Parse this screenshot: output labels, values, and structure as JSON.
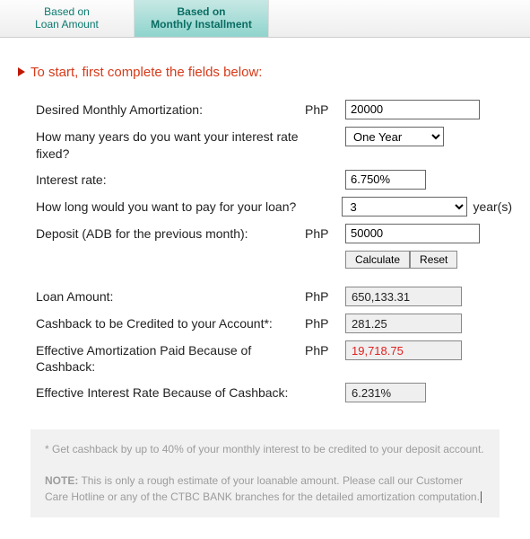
{
  "tabs": {
    "loan_amount": "Based on\nLoan Amount",
    "monthly_installment": "Based on\nMonthly Installment"
  },
  "heading": "To start, first complete the fields below:",
  "form": {
    "amortization_label": "Desired Monthly Amortization:",
    "amortization_currency": "PhP",
    "amortization_value": "20000",
    "years_fixed_label": "How many years do you want your interest rate fixed?",
    "years_fixed_value": "One Year",
    "interest_label": "Interest rate:",
    "interest_value": "6.750%",
    "pay_years_label": "How long would you want to pay for your loan?",
    "pay_years_value": "3",
    "pay_years_suffix": "year(s)",
    "deposit_label": "Deposit (ADB for the previous month):",
    "deposit_currency": "PhP",
    "deposit_value": "50000",
    "calculate": "Calculate",
    "reset": "Reset"
  },
  "results": {
    "loan_amount_label": "Loan Amount:",
    "loan_amount_currency": "PhP",
    "loan_amount_value": "650,133.31",
    "cashback_label": "Cashback to be Credited to your Account*:",
    "cashback_currency": "PhP",
    "cashback_value": "281.25",
    "eff_amort_label": "Effective Amortization Paid Because of Cashback:",
    "eff_amort_currency": "PhP",
    "eff_amort_value": "19,718.75",
    "eff_rate_label": "Effective Interest Rate Because of Cashback:",
    "eff_rate_value": "6.231%"
  },
  "footnote": {
    "cashback": "* Get cashback by up to 40% of your monthly interest to be credited to your deposit account.",
    "note_label": "NOTE:",
    "note_text": " This is only a rough estimate of your loanable amount. Please call our Customer Care Hotline or any of the CTBC BANK branches for the detailed amortization computation."
  }
}
